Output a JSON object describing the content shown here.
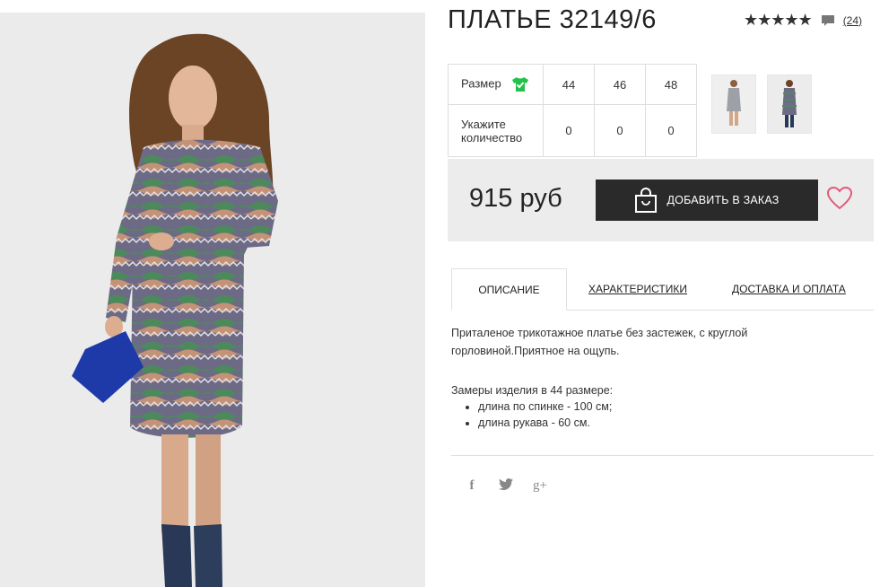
{
  "product": {
    "title": "ПЛАТЬЕ 32149/6",
    "rating_stars": "★★★★★",
    "reviews_count": "(24)"
  },
  "sizes": {
    "size_label": "Размер",
    "qty_label": "Укажите количество",
    "items": [
      {
        "size": "44",
        "qty": "0"
      },
      {
        "size": "46",
        "qty": "0"
      },
      {
        "size": "48",
        "qty": "0"
      }
    ],
    "icon": "shirt-check-icon",
    "icon_color": "#22c24a"
  },
  "purchase": {
    "price": "915 руб",
    "add_button": "ДОБАВИТЬ В ЗАКАЗ",
    "heart_color": "#e35a78"
  },
  "tabs": [
    {
      "label": "ОПИСАНИЕ",
      "active": true
    },
    {
      "label": "ХАРАКТЕРИСТИКИ",
      "active": false
    },
    {
      "label": "ДОСТАВКА И ОПЛАТА",
      "active": false
    }
  ],
  "description": {
    "text": "Приталеное трикотажное платье без застежек, с круглой горловиной.Приятное на ощупь.",
    "measurements_title": "Замеры изделия в 44 размере:",
    "measurements": [
      "длина по спинке - 100 см;",
      "длина рукава - 60 см."
    ]
  },
  "social": {
    "facebook": "f",
    "twitter": "t",
    "gplus": "g+"
  }
}
